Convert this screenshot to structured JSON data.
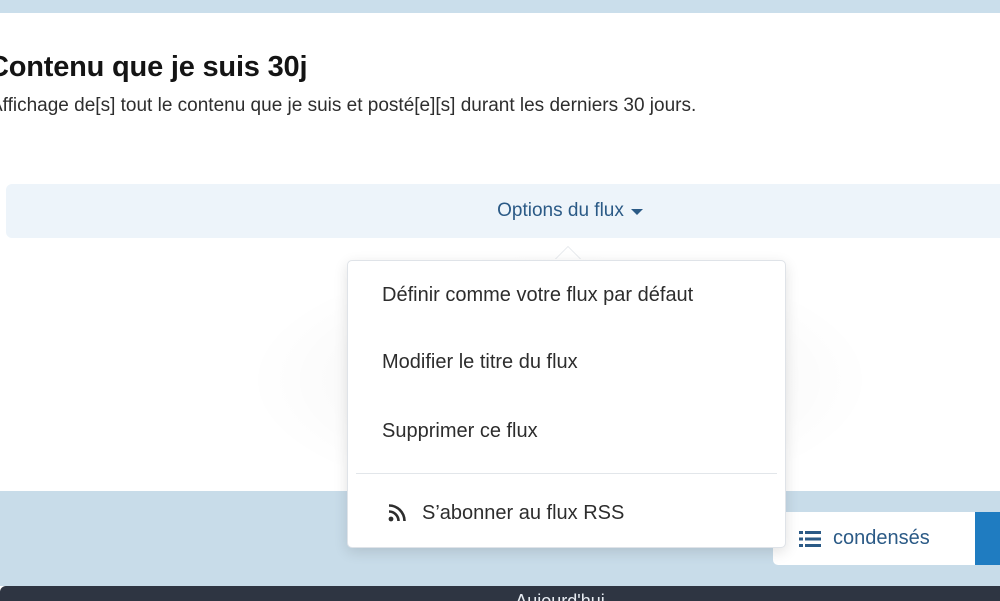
{
  "page": {
    "title": "Contenu que je suis 30j",
    "description": "Affichage de[s] tout le contenu que je suis et posté[e][s] durant les derniers 30 jours."
  },
  "options_bar": {
    "label": "Options du flux"
  },
  "menu": {
    "items": [
      {
        "label": "Définir comme votre flux par défaut"
      },
      {
        "label": "Modifier le titre du flux"
      },
      {
        "label": "Supprimer ce flux"
      }
    ],
    "rss": {
      "label": "S’abonner au flux RSS",
      "icon": "rss-icon"
    }
  },
  "view_toggle": {
    "condensed_label": "condensés",
    "icon": "list-icon"
  },
  "footer": {
    "text": "Aujourd'hui"
  },
  "colors": {
    "accent": "#2b5a86",
    "primary_button": "#1f7cc1",
    "band": "#c8dce9",
    "footer": "#2e3542"
  }
}
